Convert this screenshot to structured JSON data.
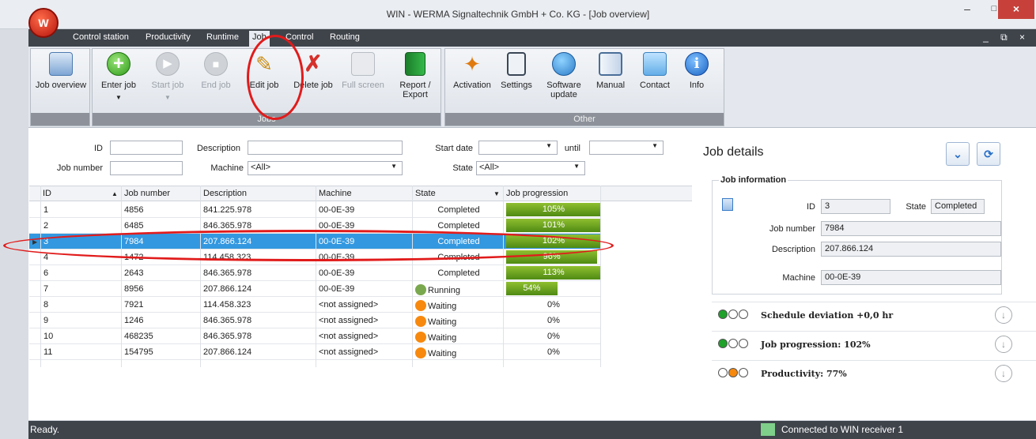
{
  "window": {
    "title": "WIN - WERMA Signaltechnik GmbH + Co. KG - [Job overview]",
    "minimize": "–",
    "maximize": "□",
    "close": "×"
  },
  "logo_text": "W",
  "menu": {
    "items": [
      "Control station",
      "Productivity",
      "Runtime",
      "Job",
      "Control",
      "Routing"
    ],
    "active": "Job",
    "mdi_controls": "_ ⧉ ×"
  },
  "ribbon": {
    "groups": [
      {
        "label": "",
        "buttons": [
          {
            "label": "Job overview",
            "icon": "job-overview-icon"
          }
        ]
      },
      {
        "label": "Jobs",
        "buttons": [
          {
            "label": "Enter job",
            "icon": "add-icon",
            "has_dropdown": true,
            "enabled": true
          },
          {
            "label": "Start job",
            "icon": "play-icon",
            "has_dropdown": true,
            "enabled": false
          },
          {
            "label": "End job",
            "icon": "stop-icon",
            "enabled": false
          },
          {
            "label": "Edit job",
            "icon": "pencil-icon",
            "enabled": true
          },
          {
            "label": "Delete job",
            "icon": "delete-icon",
            "enabled": true
          },
          {
            "label": "Full screen",
            "icon": "fullscreen-icon",
            "enabled": false
          },
          {
            "label": "Report / Export",
            "icon": "report-book-icon",
            "enabled": true
          }
        ]
      },
      {
        "label": "Other",
        "buttons": [
          {
            "label": "Activation",
            "icon": "magic-wand-icon"
          },
          {
            "label": "Settings",
            "icon": "clipboard-icon"
          },
          {
            "label": "Software update",
            "icon": "globe-update-icon"
          },
          {
            "label": "Manual",
            "icon": "book-icon"
          },
          {
            "label": "Contact",
            "icon": "envelope-icon"
          },
          {
            "label": "Info",
            "icon": "info-icon"
          }
        ]
      }
    ]
  },
  "filters": {
    "id_label": "ID",
    "id_value": "",
    "job_number_label": "Job number",
    "job_number_value": "",
    "description_label": "Description",
    "description_value": "",
    "machine_label": "Machine",
    "machine_value": "<All>",
    "start_date_label": "Start date",
    "start_date_value": "",
    "until_label": "until",
    "until_value": "",
    "state_label": "State",
    "state_value": "<All>"
  },
  "table": {
    "columns": [
      "ID",
      "Job number",
      "Description",
      "Machine",
      "State",
      "Job progression"
    ],
    "rows": [
      {
        "id": "1",
        "job_number": "4856",
        "description": "841.225.978",
        "machine": "00-0E-39",
        "state": "Completed",
        "state_dot": "",
        "progress": 105
      },
      {
        "id": "2",
        "job_number": "6485",
        "description": "846.365.978",
        "machine": "00-0E-39",
        "state": "Completed",
        "state_dot": "",
        "progress": 101
      },
      {
        "id": "3",
        "job_number": "7984",
        "description": "207.866.124",
        "machine": "00-0E-39",
        "state": "Completed",
        "state_dot": "",
        "progress": 102,
        "selected": true
      },
      {
        "id": "4",
        "job_number": "1472",
        "description": "114.458.323",
        "machine": "00-0E-39",
        "state": "Completed",
        "state_dot": "",
        "progress": 96
      },
      {
        "id": "6",
        "job_number": "2643",
        "description": "846.365.978",
        "machine": "00-0E-39",
        "state": "Completed",
        "state_dot": "",
        "progress": 113
      },
      {
        "id": "7",
        "job_number": "8956",
        "description": "207.866.124",
        "machine": "00-0E-39",
        "state": "Running",
        "state_dot": "#7aa84e",
        "progress": 54
      },
      {
        "id": "8",
        "job_number": "7921",
        "description": "114.458.323",
        "machine": "<not assigned>",
        "state": "Waiting",
        "state_dot": "#f7890f",
        "progress": 0
      },
      {
        "id": "9",
        "job_number": "1246",
        "description": "846.365.978",
        "machine": "<not assigned>",
        "state": "Waiting",
        "state_dot": "#f7890f",
        "progress": 0
      },
      {
        "id": "10",
        "job_number": "468235",
        "description": "846.365.978",
        "machine": "<not assigned>",
        "state": "Waiting",
        "state_dot": "#f7890f",
        "progress": 0
      },
      {
        "id": "11",
        "job_number": "154795",
        "description": "207.866.124",
        "machine": "<not assigned>",
        "state": "Waiting",
        "state_dot": "#f7890f",
        "progress": 0
      }
    ]
  },
  "details": {
    "title": "Job details",
    "info_title": "Job information",
    "id_label": "ID",
    "id_value": "3",
    "state_label": "State",
    "state_value": "Completed",
    "job_number_label": "Job number",
    "job_number_value": "7984",
    "description_label": "Description",
    "description_value": "207.866.124",
    "machine_label": "Machine",
    "machine_value": "00-0E-39",
    "panels": [
      {
        "title": "Schedule deviation +0,0 hr",
        "lights": [
          "#1fa12a",
          "#ffffff",
          "#ffffff"
        ]
      },
      {
        "title": "Job progression: 102%",
        "lights": [
          "#1fa12a",
          "#ffffff",
          "#ffffff"
        ]
      },
      {
        "title": "Productivity: 77%",
        "lights": [
          "#ffffff",
          "#f7890f",
          "#ffffff"
        ]
      }
    ]
  },
  "statusbar": {
    "left": "Ready.",
    "right": "Connected to WIN receiver 1"
  },
  "colors": {
    "selection": "#3398e0",
    "progress": "#6fa623",
    "annotation": "#e11b1b"
  }
}
